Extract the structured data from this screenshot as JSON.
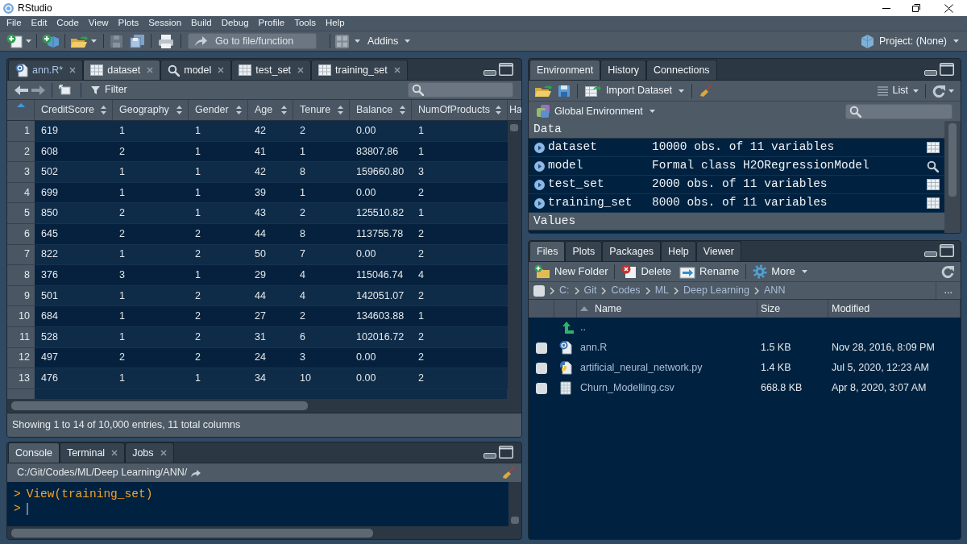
{
  "window": {
    "title": "RStudio"
  },
  "menu": [
    "File",
    "Edit",
    "Code",
    "View",
    "Plots",
    "Session",
    "Build",
    "Debug",
    "Profile",
    "Tools",
    "Help"
  ],
  "toolbar": {
    "goto_field": {
      "placeholder": "Go to file/function"
    },
    "addins": "Addins",
    "project": "Project: (None)"
  },
  "source_pane": {
    "tabs": [
      {
        "label": "ann.R*",
        "kind": "script",
        "selected": false
      },
      {
        "label": "dataset",
        "kind": "data",
        "selected": true
      },
      {
        "label": "model",
        "kind": "object",
        "selected": false
      },
      {
        "label": "test_set",
        "kind": "data",
        "selected": false
      },
      {
        "label": "training_set",
        "kind": "data",
        "selected": false
      }
    ],
    "filter": "Filter",
    "table": {
      "columns": [
        "CreditScore",
        "Geography",
        "Gender",
        "Age",
        "Tenure",
        "Balance",
        "NumOfProducts",
        "Ha"
      ],
      "rows": [
        {
          "index": "1",
          "cells": [
            "619",
            "1",
            "1",
            "42",
            "2",
            "0.00",
            "1"
          ]
        },
        {
          "index": "2",
          "cells": [
            "608",
            "2",
            "1",
            "41",
            "1",
            "83807.86",
            "1"
          ]
        },
        {
          "index": "3",
          "cells": [
            "502",
            "1",
            "1",
            "42",
            "8",
            "159660.80",
            "3"
          ]
        },
        {
          "index": "4",
          "cells": [
            "699",
            "1",
            "1",
            "39",
            "1",
            "0.00",
            "2"
          ]
        },
        {
          "index": "5",
          "cells": [
            "850",
            "2",
            "1",
            "43",
            "2",
            "125510.82",
            "1"
          ]
        },
        {
          "index": "6",
          "cells": [
            "645",
            "2",
            "2",
            "44",
            "8",
            "113755.78",
            "2"
          ]
        },
        {
          "index": "7",
          "cells": [
            "822",
            "1",
            "2",
            "50",
            "7",
            "0.00",
            "2"
          ]
        },
        {
          "index": "8",
          "cells": [
            "376",
            "3",
            "1",
            "29",
            "4",
            "115046.74",
            "4"
          ]
        },
        {
          "index": "9",
          "cells": [
            "501",
            "1",
            "2",
            "44",
            "4",
            "142051.07",
            "2"
          ]
        },
        {
          "index": "10",
          "cells": [
            "684",
            "1",
            "2",
            "27",
            "2",
            "134603.88",
            "1"
          ]
        },
        {
          "index": "11",
          "cells": [
            "528",
            "1",
            "2",
            "31",
            "6",
            "102016.72",
            "2"
          ]
        },
        {
          "index": "12",
          "cells": [
            "497",
            "2",
            "2",
            "24",
            "3",
            "0.00",
            "2"
          ]
        },
        {
          "index": "13",
          "cells": [
            "476",
            "1",
            "1",
            "34",
            "10",
            "0.00",
            "2"
          ]
        }
      ]
    },
    "status": "Showing 1 to 14 of 10,000 entries, 11 total columns"
  },
  "console_pane": {
    "tabs": [
      {
        "label": "Console",
        "closable": false,
        "selected": true
      },
      {
        "label": "Terminal",
        "closable": true,
        "selected": false
      },
      {
        "label": "Jobs",
        "closable": true,
        "selected": false
      }
    ],
    "path": "C:/Git/Codes/ML/Deep Learning/ANN/",
    "lines": [
      {
        "prompt": ">",
        "command": "View(training_set)"
      }
    ],
    "input_prompt": ">"
  },
  "environment_pane": {
    "tabs": [
      {
        "label": "Environment",
        "selected": true
      },
      {
        "label": "History",
        "selected": false
      },
      {
        "label": "Connections",
        "selected": false
      }
    ],
    "import": "Import Dataset",
    "view_mode": "List",
    "scope": "Global Environment",
    "sections": [
      {
        "title": "Data",
        "items": [
          {
            "name": "dataset",
            "value": "10000 obs. of 11 variables",
            "kind": "data"
          },
          {
            "name": "model",
            "value": "Formal class H2ORegressionModel",
            "kind": "object"
          },
          {
            "name": "test_set",
            "value": "2000 obs. of 11 variables",
            "kind": "data"
          },
          {
            "name": "training_set",
            "value": "8000 obs. of 11 variables",
            "kind": "data"
          }
        ]
      },
      {
        "title": "Values"
      }
    ]
  },
  "files_pane": {
    "tabs": [
      {
        "label": "Files",
        "selected": true
      },
      {
        "label": "Plots",
        "selected": false
      },
      {
        "label": "Packages",
        "selected": false
      },
      {
        "label": "Help",
        "selected": false
      },
      {
        "label": "Viewer",
        "selected": false
      }
    ],
    "actions": [
      {
        "label": "New Folder",
        "kind": "new_folder"
      },
      {
        "label": "Delete",
        "kind": "delete"
      },
      {
        "label": "Rename",
        "kind": "rename"
      },
      {
        "label": "More",
        "kind": "more"
      }
    ],
    "select_all": {
      "checked": false
    },
    "breadcrumb": [
      "C:",
      "Git",
      "Codes",
      "ML",
      "Deep Learning",
      "ANN"
    ],
    "overflow": "...",
    "columns": [
      {
        "label": "Name",
        "sorted": true
      },
      {
        "label": "Size",
        "sorted": false
      },
      {
        "label": "Modified",
        "sorted": false
      }
    ],
    "parent": "..",
    "files": [
      {
        "name": "ann.R",
        "size": "1.5 KB",
        "modified": "Nov 28, 2016, 8:09 PM",
        "kind": "r",
        "checked": false
      },
      {
        "name": "artificial_neural_network.py",
        "size": "1.4 KB",
        "modified": "Jul 5, 2020, 12:23 AM",
        "kind": "python",
        "checked": false
      },
      {
        "name": "Churn_Modelling.csv",
        "size": "668.8 KB",
        "modified": "Apr 8, 2020, 3:07 AM",
        "kind": "csv",
        "checked": false
      }
    ]
  }
}
